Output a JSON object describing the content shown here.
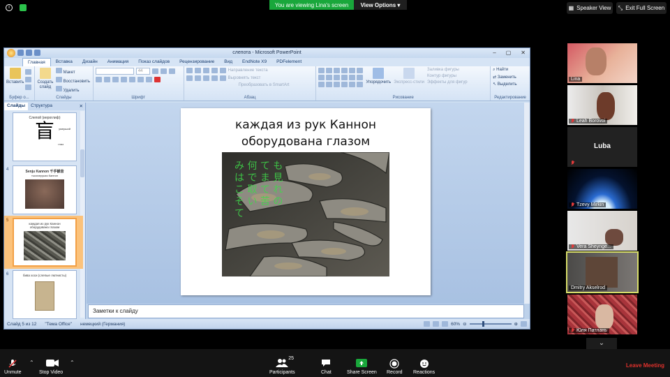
{
  "zoom": {
    "banner": "You are viewing Lina's screen",
    "view_options": "View Options",
    "speaker_view": "Speaker View",
    "exit_full_screen": "Exit Full Screen",
    "participants_count": "25",
    "toolbar": {
      "unmute": "Unmute",
      "stop_video": "Stop Video",
      "participants": "Participants",
      "chat": "Chat",
      "share_screen": "Share Screen",
      "record": "Record",
      "reactions": "Reactions",
      "leave": "Leave Meeting"
    },
    "participants": [
      {
        "name": "Lina"
      },
      {
        "name": "Leah Borovoi"
      },
      {
        "name": "Luba"
      },
      {
        "name": "Tzevy Mirkin"
      },
      {
        "name": "Vera Sheynge..."
      },
      {
        "name": "Dmitry Akselrod"
      },
      {
        "name": "Юля Патлань"
      }
    ]
  },
  "ppt": {
    "window_title": "слепота - Microsoft PowerPoint",
    "tabs": [
      "Главная",
      "Вставка",
      "Дизайн",
      "Анимация",
      "Показ слайдов",
      "Рецензирование",
      "Вид",
      "EndNote X9",
      "PDFelement"
    ],
    "ribbon": {
      "paste": "Вставить",
      "create_slide": "Создать слайд",
      "layout": "Макет",
      "restore": "Восстановить",
      "delete": "Удалить",
      "font_size": "44",
      "text_direction": "Направление текста",
      "align_text": "Выровнять текст",
      "smartart": "Преобразовать в SmartArt",
      "arrange": "Упорядочить",
      "express_styles": "Экспресс-стили",
      "shape_fill": "Заливка фигуры",
      "shape_outline": "Контур фигуры",
      "shape_effects": "Эффекты для фигур",
      "find": "Найти",
      "replace": "Заменить",
      "select": "Выделить",
      "groups": {
        "clipboard": "Буфер о...",
        "slides": "Слайды",
        "font": "Шрифт",
        "paragraph": "Абзац",
        "drawing": "Рисование",
        "editing": "Редактирование"
      }
    },
    "panel_tabs": [
      "Слайды",
      "Структура"
    ],
    "thumbs": [
      {
        "num": "",
        "text": "Слепой (иероглиф)",
        "kanji": "盲",
        "label1": "умерший",
        "label2": "глаз"
      },
      {
        "num": "4",
        "text": "Senju Kannon 千手観音",
        "sub": "тысячерукая Каннон"
      },
      {
        "num": "5",
        "text": "каждая из рук Каннон оборудована глазом"
      },
      {
        "num": "6",
        "text": "бива хоси (слепые лютнисты)"
      }
    ],
    "slide": {
      "title": "каждая из рук Каннон оборудована глазом",
      "image_caption": "み 何 て も は で ま 見 こ 取 て れ そ い 苦 の て"
    },
    "notes_placeholder": "Заметки к слайду",
    "status": {
      "slide_num": "Слайд 5 из 12",
      "theme": "\"Тема Office\"",
      "language": "немецкий (Германия)",
      "zoom": "60%"
    }
  }
}
